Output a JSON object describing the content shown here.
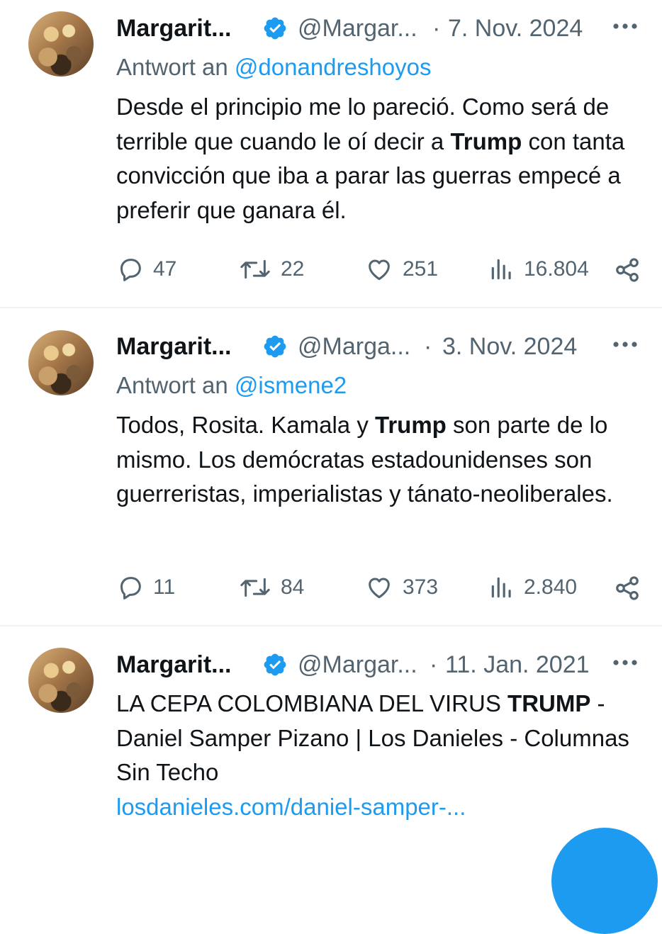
{
  "tweets": [
    {
      "name": "Margarit...",
      "handle": "@Margar...",
      "separator": "·",
      "date": "7. Nov. 2024",
      "reply_prefix": "Antwort an",
      "reply_to": "@donandreshoyos",
      "text_parts": [
        "Desde el principio me lo pareció. Como será de terrible que cuando le oí decir a ",
        "Trump",
        " con tanta convicción que iba a parar las guerras empecé a preferir que ganara él."
      ],
      "replies": "47",
      "retweets": "22",
      "likes": "251",
      "views": "16.804"
    },
    {
      "name": "Margarit...",
      "handle": "@Marga...",
      "separator": "·",
      "date": "3. Nov. 2024",
      "reply_prefix": "Antwort an",
      "reply_to": "@ismene2",
      "text_parts": [
        "Todos, Rosita. Kamala y ",
        "Trump",
        " son parte de lo mismo. Los demócratas estadounidenses son guerreristas, imperialistas y tánato-neoliberales."
      ],
      "replies": "11",
      "retweets": "84",
      "likes": "373",
      "views": "2.840"
    },
    {
      "name": "Margarit...",
      "handle": "@Margar...",
      "separator": "·",
      "date": "11. Jan. 2021",
      "text_parts": [
        "LA CEPA COLOMBIANA DEL VIRUS ",
        "TRUMP",
        " - Daniel Samper Pizano | Los Danieles - Columnas Sin Techo"
      ],
      "link": "losdanieles.com/daniel-samper-..."
    }
  ],
  "icons": {
    "reply": "speech-bubble-icon",
    "retweet": "retweet-icon",
    "like": "heart-icon",
    "views": "bar-chart-icon",
    "share": "share-icon",
    "more": "ellipsis-icon",
    "verified": "verified-badge-icon"
  },
  "colors": {
    "accent": "#1d9bf0",
    "text": "#0f1419",
    "secondary": "#536471",
    "divider": "#eff3f4"
  }
}
